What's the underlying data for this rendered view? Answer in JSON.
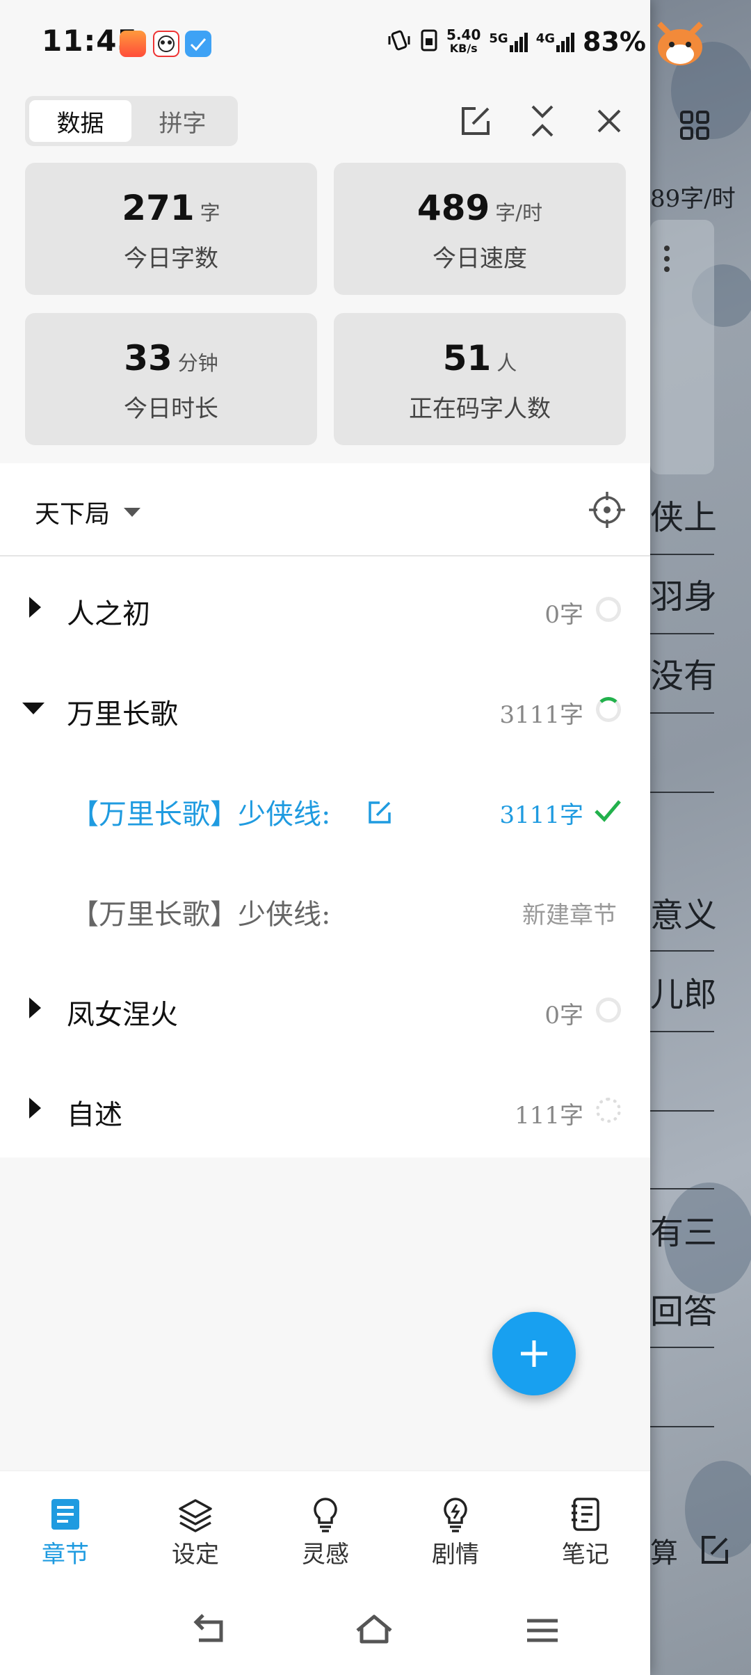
{
  "status_bar": {
    "time": "11:45",
    "net_speed_value": "5.40",
    "net_speed_unit": "KB/s",
    "signal_1": "5G",
    "signal_2": "4G",
    "battery": "83%"
  },
  "tabs": [
    {
      "label": "数据",
      "active": true
    },
    {
      "label": "拼字",
      "active": false
    }
  ],
  "stats": [
    {
      "value": "271",
      "unit": "字",
      "label": "今日字数"
    },
    {
      "value": "489",
      "unit": "字/时",
      "label": "今日速度"
    },
    {
      "value": "33",
      "unit": "分钟",
      "label": "今日时长"
    },
    {
      "value": "51",
      "unit": "人",
      "label": "正在码字人数"
    }
  ],
  "book": {
    "title": "天下局"
  },
  "rows": [
    {
      "title": "人之初",
      "count": "0字",
      "expanded": false
    },
    {
      "title": "万里长歌",
      "count": "3111字",
      "expanded": true
    },
    {
      "title": "【万里长歌】少侠线:",
      "count": "3111字",
      "active": true
    },
    {
      "title": "【万里长歌】少侠线:",
      "count": "新建章节"
    },
    {
      "title": "凤女涅火",
      "count": "0字",
      "expanded": false
    },
    {
      "title": "自述",
      "count": "111字",
      "expanded": false
    }
  ],
  "bottom_nav": [
    {
      "label": "章节",
      "icon": "chapter-icon",
      "active": true
    },
    {
      "label": "设定",
      "icon": "layers-icon"
    },
    {
      "label": "灵感",
      "icon": "lightbulb-icon"
    },
    {
      "label": "剧情",
      "icon": "lightning-bulb-icon"
    },
    {
      "label": "笔记",
      "icon": "notebook-icon"
    }
  ],
  "background_text": {
    "speed": "89字/时",
    "lines": [
      "侠上",
      "羽身",
      "没有",
      "意义",
      "儿郎",
      "有三",
      "回答",
      "算"
    ]
  },
  "colors": {
    "accent": "#1f9be0",
    "fab": "#18a0f0",
    "check": "#22b14c"
  }
}
